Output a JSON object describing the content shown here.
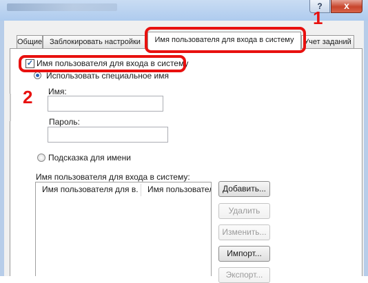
{
  "window": {
    "help_label": "?",
    "close_label": "x"
  },
  "tabs": [
    {
      "label": "Общие"
    },
    {
      "label": "Заблокировать настройки"
    },
    {
      "label": "Имя пользователя для входа в систему"
    },
    {
      "label": "Учет заданий"
    }
  ],
  "callouts": {
    "step1": "1",
    "step2": "2"
  },
  "login": {
    "checkbox_label": "Имя пользователя для входа в систему",
    "checkbox_mark": "✓",
    "checked": true,
    "radio_custom_label": "Использовать специальное имя",
    "name_label": "Имя:",
    "name_value": "",
    "password_label": "Пароль:",
    "password_value": "",
    "radio_hint_label": "Подсказка для имени",
    "list_label": "Имя пользователя для входа в систему:",
    "columns": [
      "Имя пользователя для в...",
      "Имя пользователя"
    ]
  },
  "buttons": {
    "add": "Добавить...",
    "delete": "Удалить",
    "edit": "Изменить...",
    "import": "Импорт...",
    "export": "Экспорт..."
  }
}
